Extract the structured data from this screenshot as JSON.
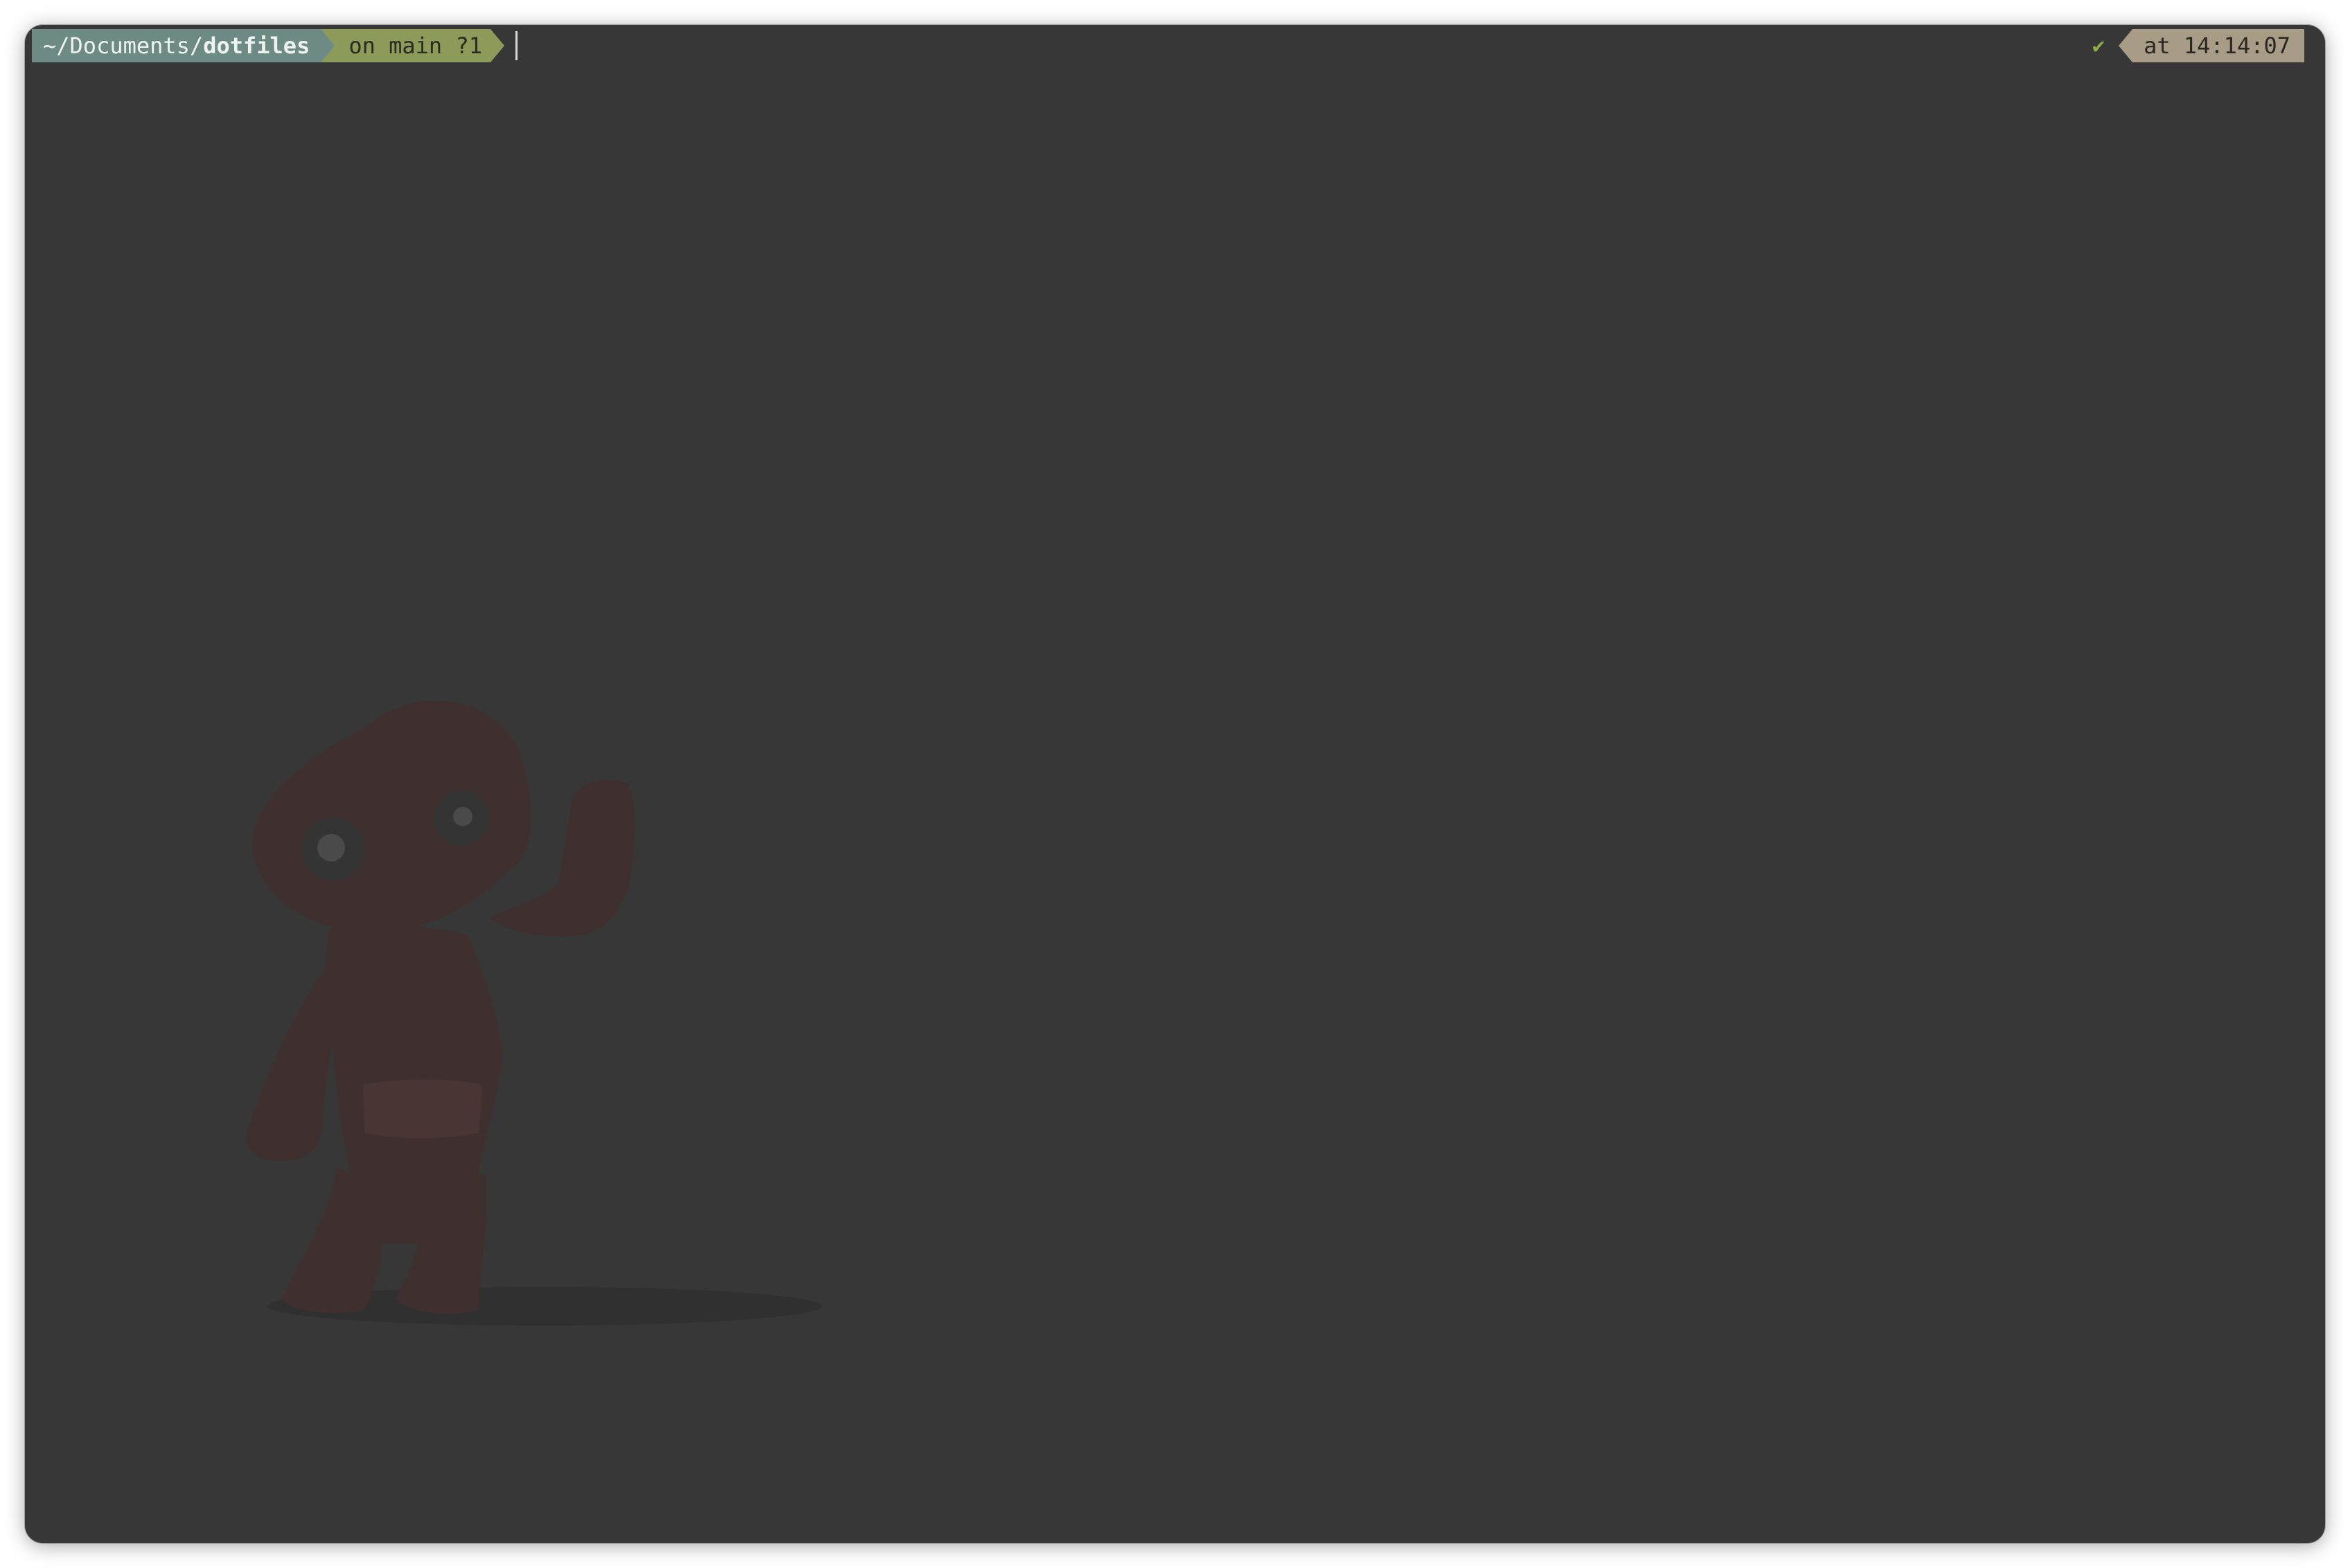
{
  "terminal": {
    "prompt": {
      "dir_prefix": "~/Documents/",
      "dir_name": "dotfiles",
      "git_status": "on main ?1"
    },
    "right_prompt": {
      "status_icon": "✔",
      "time": "at 14:14:07"
    }
  },
  "icons": {
    "status": "checkmark-icon",
    "mascot": "sackboy-figure"
  },
  "colors": {
    "background": "#373737",
    "dir_segment": "#6e8a84",
    "git_segment": "#8c9a5a",
    "time_segment": "#a89c86",
    "status_check": "#8cae46",
    "mascot": "#3f2f2f"
  }
}
